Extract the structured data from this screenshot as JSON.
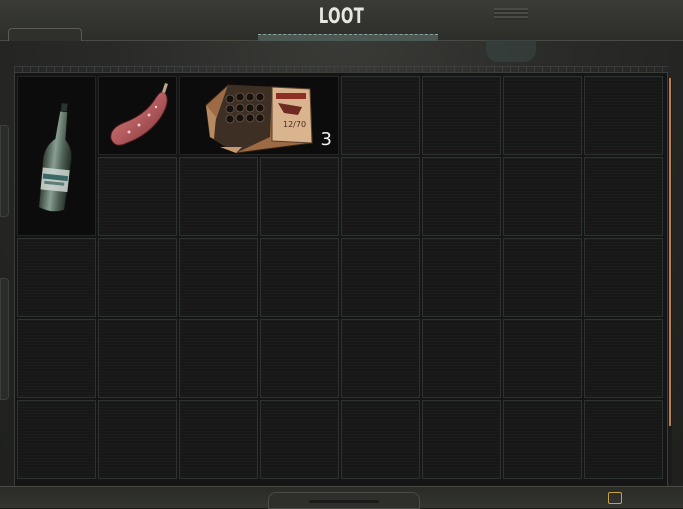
{
  "window": {
    "title": "LOOT"
  },
  "inventory": {
    "columns": 8,
    "rows": 5,
    "items": [
      {
        "name": "water-bottle",
        "icon": "glass-bottle-icon",
        "quantity": null
      },
      {
        "name": "salami",
        "icon": "sausage-icon",
        "quantity": null
      },
      {
        "name": "shotgun-shells-box",
        "icon": "ammo-box-icon",
        "box_text": "12/70",
        "quantity": "3"
      }
    ]
  },
  "colors": {
    "scrollbar_accent": "#c07b4a",
    "cell_border": "#2c322f",
    "background": "#141514"
  }
}
